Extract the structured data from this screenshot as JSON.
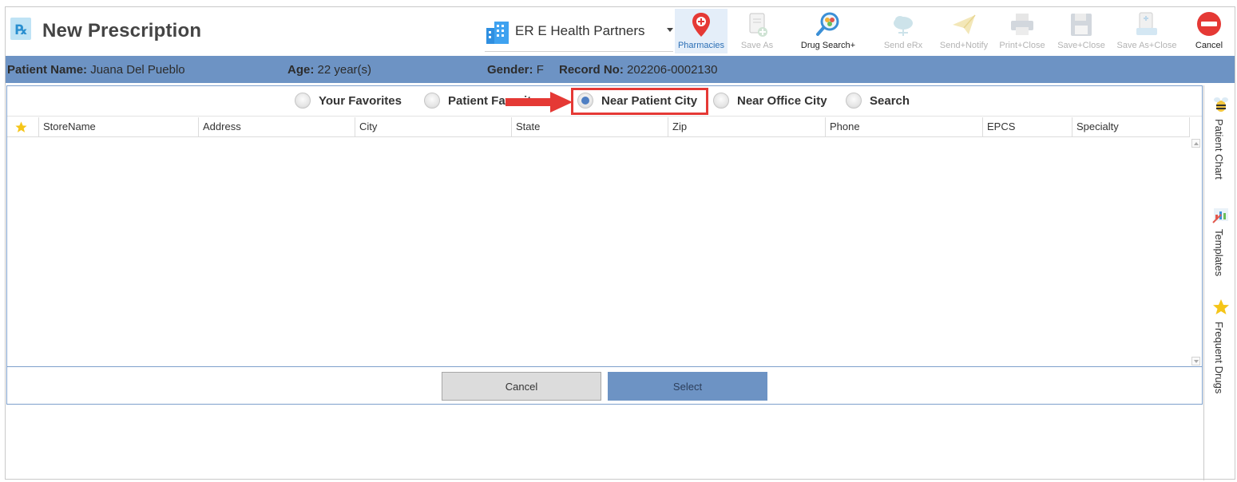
{
  "window": {
    "title": "New Prescription"
  },
  "practice_selector": {
    "value": "ER E Health Partners"
  },
  "toolbar": {
    "buttons": [
      {
        "label": "Pharmacies",
        "icon": "map-pin-icon",
        "state": "active"
      },
      {
        "label": "Save As",
        "icon": "document-add-icon",
        "state": "disabled"
      },
      {
        "label": "Drug Search+",
        "icon": "magnify-pills-icon",
        "state": "enabled"
      },
      {
        "label": "Send eRx",
        "icon": "cloud-send-icon",
        "state": "disabled"
      },
      {
        "label": "Send+Notify",
        "icon": "paper-plane-icon",
        "state": "disabled"
      },
      {
        "label": "Print+Close",
        "icon": "printer-icon",
        "state": "disabled"
      },
      {
        "label": "Save+Close",
        "icon": "floppy-disk-icon",
        "state": "disabled"
      },
      {
        "label": "Save As+Close",
        "icon": "document-stack-icon",
        "state": "disabled"
      },
      {
        "label": "Cancel",
        "icon": "no-entry-icon",
        "state": "enabled"
      }
    ]
  },
  "patient": {
    "name_label": "Patient Name:",
    "name_value": "Juana Del Pueblo",
    "age_label": "Age:",
    "age_value": "22 year(s)",
    "gender_label": "Gender:",
    "gender_value": "F",
    "record_label": "Record No:",
    "record_value": "202206-0002130"
  },
  "pharmacy_filter": {
    "options": [
      {
        "label": "Your Favorites",
        "selected": false
      },
      {
        "label": "Patient Favorites",
        "selected": false
      },
      {
        "label": "Near Patient City",
        "selected": true
      },
      {
        "label": "Near Office City",
        "selected": false
      },
      {
        "label": "Search",
        "selected": false
      }
    ]
  },
  "grid": {
    "columns": [
      "StoreName",
      "Address",
      "City",
      "State",
      "Zip",
      "Phone",
      "EPCS",
      "Specialty"
    ],
    "rows": []
  },
  "footer": {
    "cancel_label": "Cancel",
    "select_label": "Select"
  },
  "side_rail": {
    "items": [
      {
        "label": "Patient Chart",
        "icon": "bee-icon"
      },
      {
        "label": "Templates",
        "icon": "pencil-chart-icon"
      },
      {
        "label": "Frequent Drugs",
        "icon": "star-icon"
      }
    ]
  },
  "colors": {
    "accent": "#6d93c4",
    "highlight_border": "#e53935",
    "radio_selected": "#4f7fc3"
  }
}
